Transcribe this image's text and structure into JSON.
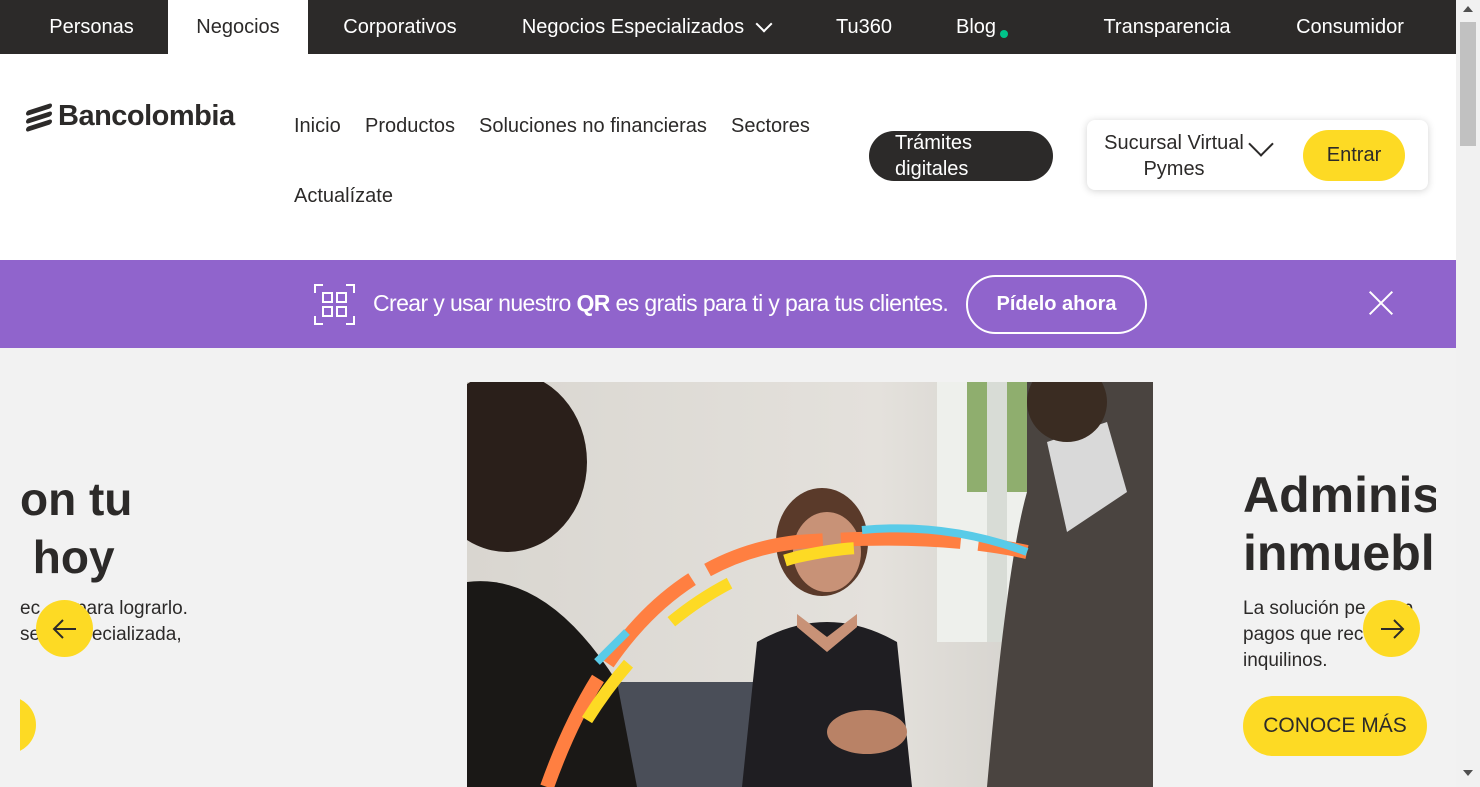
{
  "topnav": {
    "tabs": [
      {
        "label": "Personas"
      },
      {
        "label": "Negocios"
      },
      {
        "label": "Corporativos"
      },
      {
        "label": "Negocios Especializados"
      },
      {
        "label": "Tu360"
      },
      {
        "label": "Blog"
      },
      {
        "label": "Transparencia"
      },
      {
        "label": "Consumidor"
      }
    ],
    "active_tab": "Negocios"
  },
  "header": {
    "logo_text": "Bancolombia",
    "menu": [
      "Inicio",
      "Productos",
      "Soluciones no financieras",
      "Sectores",
      "Actualízate"
    ],
    "tramites_label": "Trámites digitales",
    "sucursal_label": "Sucursal Virtual Pymes",
    "entrar_label": "Entrar"
  },
  "promo": {
    "text_before": "Crear y usar nuestro ",
    "text_bold": "QR",
    "text_after": " es gratis para ti y para tus clientes.",
    "button_label": "Pídelo ahora"
  },
  "carousel": {
    "left_slide": {
      "title": "on tu\n hoy",
      "body": "ec    s para lograrlo.\nse    especializada,"
    },
    "right_slide": {
      "title": "Adminis\ninmuebl",
      "body": "La solución pe    a p\npagos que rec    de\ninquilinos.",
      "button_label": "CONOCE MÁS"
    }
  },
  "colors": {
    "brand_yellow": "#fdda24",
    "dark": "#2c2a29",
    "promo_purple": "#9064cc",
    "blog_dot": "#00c389"
  }
}
